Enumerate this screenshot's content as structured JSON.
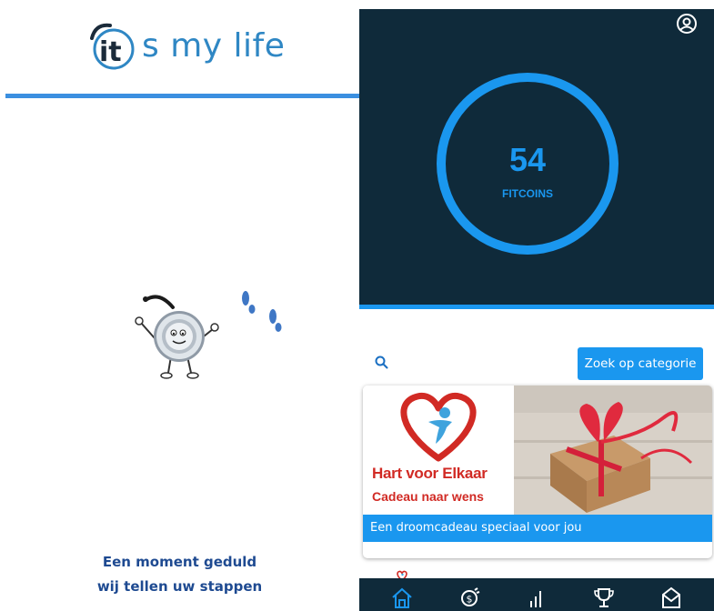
{
  "left": {
    "logo_it": "it",
    "logo_slogan": "s my life",
    "wait_line1": "Een moment geduld",
    "wait_line2": "wij tellen uw stappen"
  },
  "right": {
    "coins": {
      "value": "54",
      "label": "FITCOINS"
    },
    "search": {
      "icon": "search-icon"
    },
    "category_button": "Zoek op categorie",
    "card": {
      "brand_name": "Hart voor Elkaar",
      "brand_tagline": "Cadeau naar wens",
      "caption": "Een droomcadeau speciaal voor jou"
    },
    "bottom_nav": [
      {
        "icon": "home-icon",
        "active": true
      },
      {
        "icon": "coins-icon",
        "active": false
      },
      {
        "icon": "stats-icon",
        "active": false
      },
      {
        "icon": "trophy-icon",
        "active": false
      },
      {
        "icon": "mail-icon",
        "active": false
      }
    ]
  },
  "colors": {
    "accent": "#1a97ef",
    "dark_bg": "#0f2a3a",
    "logo_blue": "#2f87c4",
    "brand_red": "#d12a24",
    "text_navy": "#1e4a91"
  }
}
